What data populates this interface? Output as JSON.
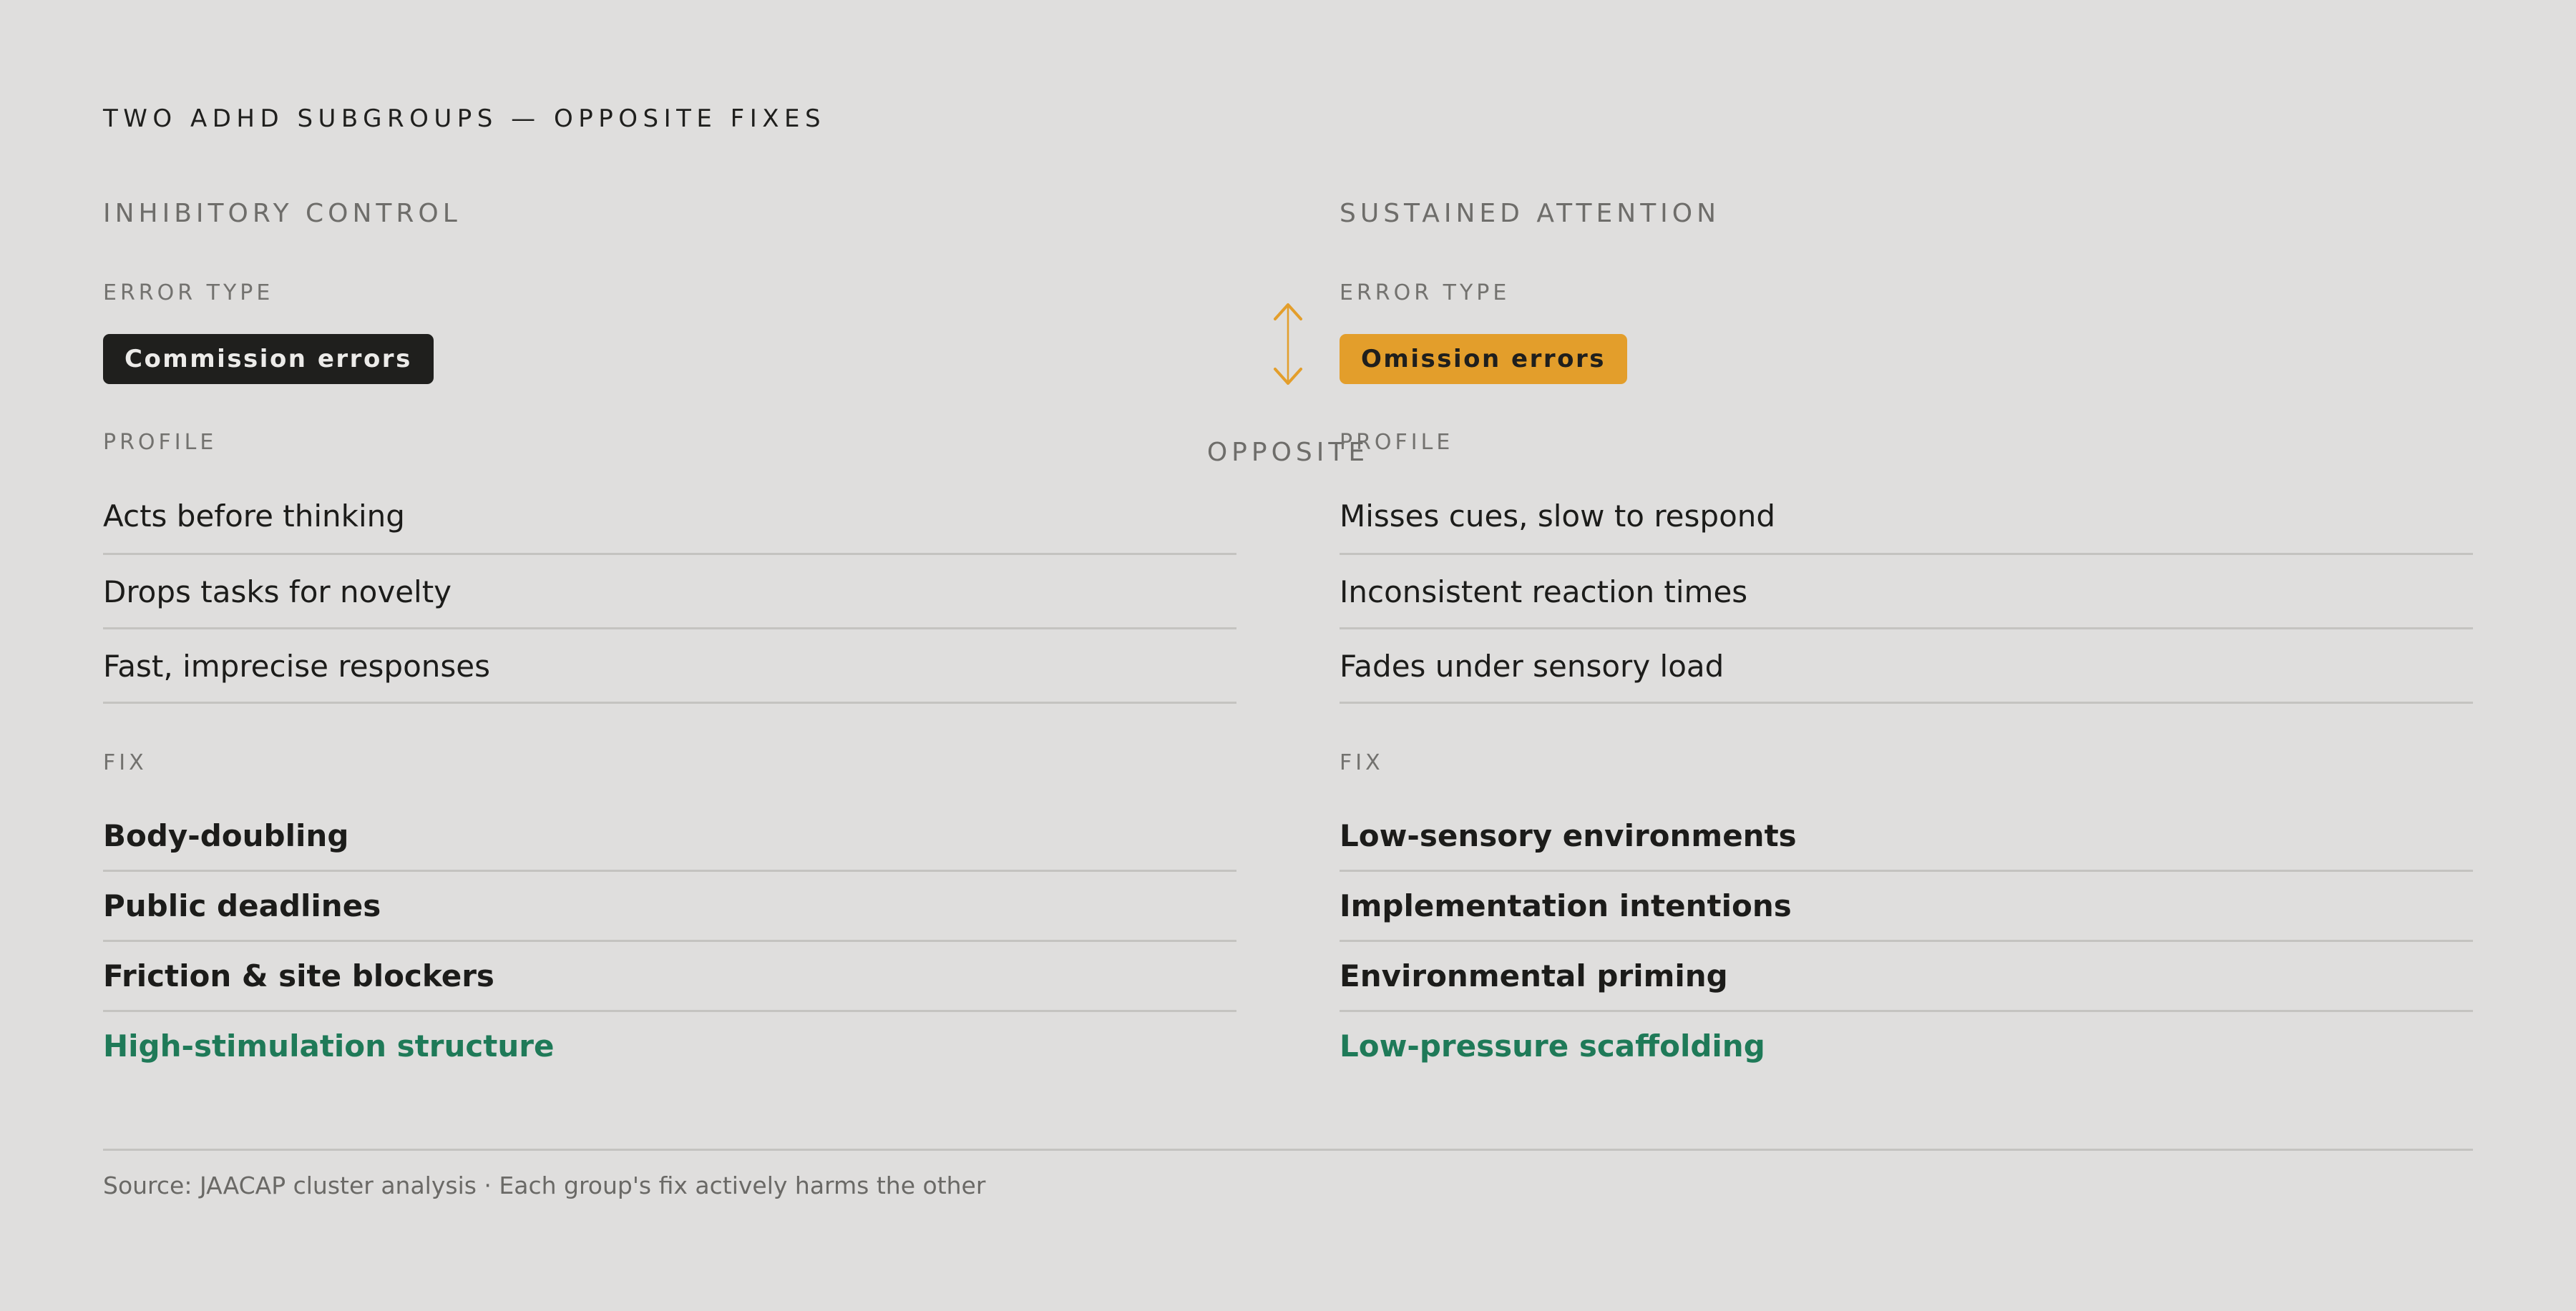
{
  "title": "TWO ADHD SUBGROUPS — OPPOSITE FIXES",
  "accent_color": "#e39e2b",
  "highlight_color": "#1f7a58",
  "left": {
    "heading": "INHIBITORY CONTROL",
    "error_type_label": "ERROR TYPE",
    "error_type": "Commission errors",
    "profile_label": "PROFILE",
    "profile": [
      "Acts before thinking",
      "Drops tasks for novelty",
      "Fast, imprecise responses"
    ],
    "fix_label": "FIX",
    "fixes": [
      "Body-doubling",
      "Public deadlines",
      "Friction & site blockers",
      "High-stimulation structure"
    ]
  },
  "right": {
    "heading": "SUSTAINED ATTENTION",
    "error_type_label": "ERROR TYPE",
    "error_type": "Omission errors",
    "profile_label": "PROFILE",
    "profile": [
      "Misses cues, slow to respond",
      "Inconsistent reaction times",
      "Fades under sensory load"
    ],
    "fix_label": "FIX",
    "fixes": [
      "Low-sensory environments",
      "Implementation intentions",
      "Environmental priming",
      "Low-pressure scaffolding"
    ]
  },
  "divider": {
    "label": "OPPOSITE",
    "icon": "double-arrow-icon"
  },
  "source": "Source: JAACAP cluster analysis · Each group's fix actively harms the other"
}
